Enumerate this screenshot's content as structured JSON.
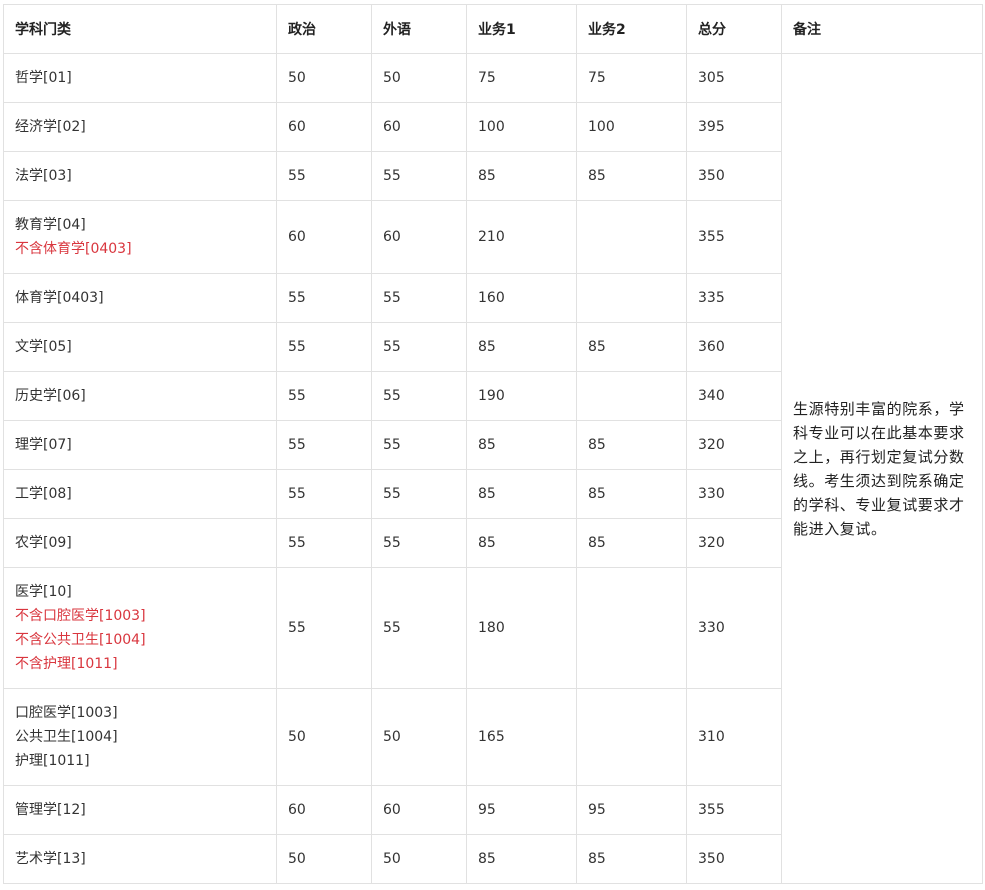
{
  "headers": [
    "学科门类",
    "政治",
    "外语",
    "业务1",
    "业务2",
    "总分",
    "备注"
  ],
  "remark": "生源特别丰富的院系，学科专业可以在此基本要求之上，再行划定复试分数线。考生须达到院系确定的学科、专业复试要求才能进入复试。",
  "rows": [
    {
      "subject": [
        "哲学[01]"
      ],
      "notes": [],
      "politics": "50",
      "language": "50",
      "business1": "75",
      "business2": "75",
      "total": "305"
    },
    {
      "subject": [
        "经济学[02]"
      ],
      "notes": [],
      "politics": "60",
      "language": "60",
      "business1": "100",
      "business2": "100",
      "total": "395"
    },
    {
      "subject": [
        "法学[03]"
      ],
      "notes": [],
      "politics": "55",
      "language": "55",
      "business1": "85",
      "business2": "85",
      "total": "350"
    },
    {
      "subject": [
        "教育学[04]"
      ],
      "notes": [
        "不含体育学[0403]"
      ],
      "politics": "60",
      "language": "60",
      "business1": "210",
      "business2": "",
      "total": "355"
    },
    {
      "subject": [
        "体育学[0403]"
      ],
      "notes": [],
      "politics": "55",
      "language": "55",
      "business1": "160",
      "business2": "",
      "total": "335"
    },
    {
      "subject": [
        "文学[05]"
      ],
      "notes": [],
      "politics": "55",
      "language": "55",
      "business1": "85",
      "business2": "85",
      "total": "360"
    },
    {
      "subject": [
        "历史学[06]"
      ],
      "notes": [],
      "politics": "55",
      "language": "55",
      "business1": "190",
      "business2": "",
      "total": "340"
    },
    {
      "subject": [
        "理学[07]"
      ],
      "notes": [],
      "politics": "55",
      "language": "55",
      "business1": "85",
      "business2": "85",
      "total": "320"
    },
    {
      "subject": [
        "工学[08]"
      ],
      "notes": [],
      "politics": "55",
      "language": "55",
      "business1": "85",
      "business2": "85",
      "total": "330"
    },
    {
      "subject": [
        "农学[09]"
      ],
      "notes": [],
      "politics": "55",
      "language": "55",
      "business1": "85",
      "business2": "85",
      "total": "320"
    },
    {
      "subject": [
        "医学[10]"
      ],
      "notes": [
        "不含口腔医学[1003]",
        "不含公共卫生[1004]",
        "不含护理[1011]"
      ],
      "politics": "55",
      "language": "55",
      "business1": "180",
      "business2": "",
      "total": "330"
    },
    {
      "subject": [
        "口腔医学[1003]",
        "公共卫生[1004]",
        "护理[1011]"
      ],
      "notes": [],
      "politics": "50",
      "language": "50",
      "business1": "165",
      "business2": "",
      "total": "310"
    },
    {
      "subject": [
        "管理学[12]"
      ],
      "notes": [],
      "politics": "60",
      "language": "60",
      "business1": "95",
      "business2": "95",
      "total": "355"
    },
    {
      "subject": [
        "艺术学[13]"
      ],
      "notes": [],
      "politics": "50",
      "language": "50",
      "business1": "85",
      "business2": "85",
      "total": "350"
    }
  ],
  "colors": {
    "note_red": "#d9363e",
    "border": "#e1e1e1",
    "text": "#333333"
  }
}
